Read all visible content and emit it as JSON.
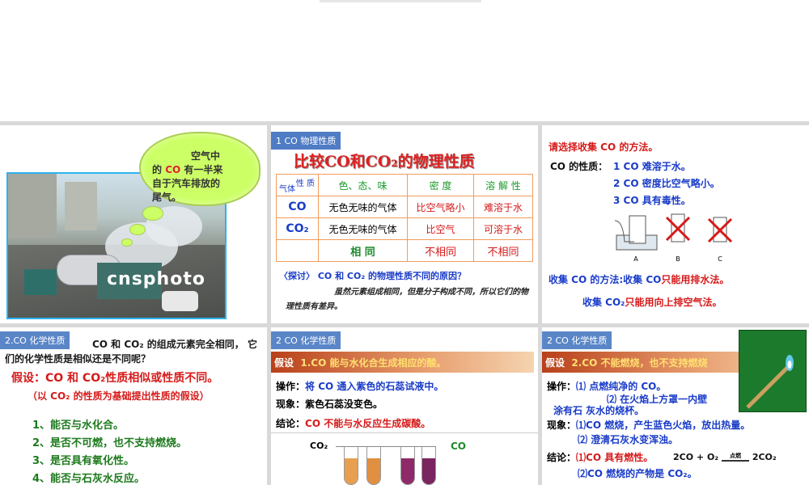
{
  "slide1": {
    "cloud_lines": [
      "空气中",
      "的",
      "CO",
      "有一半来",
      "自于汽车排放的",
      "尾气。"
    ],
    "watermark": "cnsphoto"
  },
  "slide2": {
    "tag": "1 CO 物理性质",
    "title": "比较CO和CO₂的物理性质",
    "header_corner_top": "性 质",
    "header_corner_bottom": "气体",
    "headers": [
      "色、态、味",
      "密    度",
      "溶 解 性"
    ],
    "rows": [
      {
        "gas": "CO",
        "color": "无色无味的气体",
        "density": "比空气略小",
        "solubility": "难溶于水"
      },
      {
        "gas": "CO₂",
        "color": "无色无味的气体",
        "density": "比空气",
        "solubility": "可溶于水"
      },
      {
        "gas": "",
        "color": "相    同",
        "density": "不相同",
        "solubility": "不相同"
      }
    ],
    "question": "〈探讨〉 CO 和 CO₂ 的物理性质不同的原因？",
    "answer": "虽然元素组成相同，但是分子构成不同，所以它们的物理性质有差异。"
  },
  "slide3": {
    "prompt": "请选择收集 CO 的方法。",
    "prop_label": "CO 的性质：",
    "props": [
      "1  CO 难溶于水。",
      "2  CO 密度比空气略小。",
      "3  CO 具有毒性。"
    ],
    "apparatus_labels": [
      "A",
      "B",
      "C"
    ],
    "method1_a": "收集 CO 的方法:收集   CO",
    "method1_b": "只能用排水法。",
    "method2_a": "收集   CO₂",
    "method2_b": "只能用向上排空气法。"
  },
  "slide4": {
    "tag": "2.CO 化学性质",
    "intro": "CO 和 CO₂ 的组成元素完全相同，  它们的化学性质是相似还是不同呢？",
    "hypothesis": "假设：CO 和 CO₂性质相似或性质不同。",
    "sub": "（以 CO₂ 的性质为基础提出性质的假设）",
    "items": [
      "1、能否与水化合。",
      "2、是否不可燃，也不支持燃烧。",
      "3、是否具有氧化性。",
      "4、能否与石灰水反应。"
    ]
  },
  "slide5": {
    "tag": "2 CO 化学性质",
    "bar_label": "假设",
    "bar_text": "1.CO 能与水化合生成相应的酸。",
    "op_label": "操作：",
    "op_text": "将 CO 通入紫色的石蕊试液中。",
    "phen_label": "现象：",
    "phen_text": "紫色石蕊没变色。",
    "concl_label": "结论：",
    "concl_text": "CO 不能与水反应生成碳酸。",
    "tube_left": "CO₂",
    "tube_right": "CO"
  },
  "slide6": {
    "tag": "2 CO 化学性质",
    "bar_label": "假设",
    "bar_text": "2.CO 不能燃烧，也不支持燃烧",
    "op_label": "操作：",
    "op1": "⑴ 点燃纯净的 CO。",
    "op2": "⑵ 在火焰上方罩一内壁",
    "op2b": "涂有石    灰水的烧杯。",
    "phen_label": "现象：",
    "phen1": "⑴CO 燃烧，产生蓝色火焰，放出热量。",
    "phen2": "⑵ 澄清石灰水变浑浊。",
    "concl_label": "结论：",
    "concl1": "⑴CO 具有燃性。",
    "equation_left": "2CO + O₂",
    "equation_cond": "点燃",
    "equation_right": "2CO₂",
    "concl2": "⑵CO 燃烧的产物是 CO₂。"
  }
}
